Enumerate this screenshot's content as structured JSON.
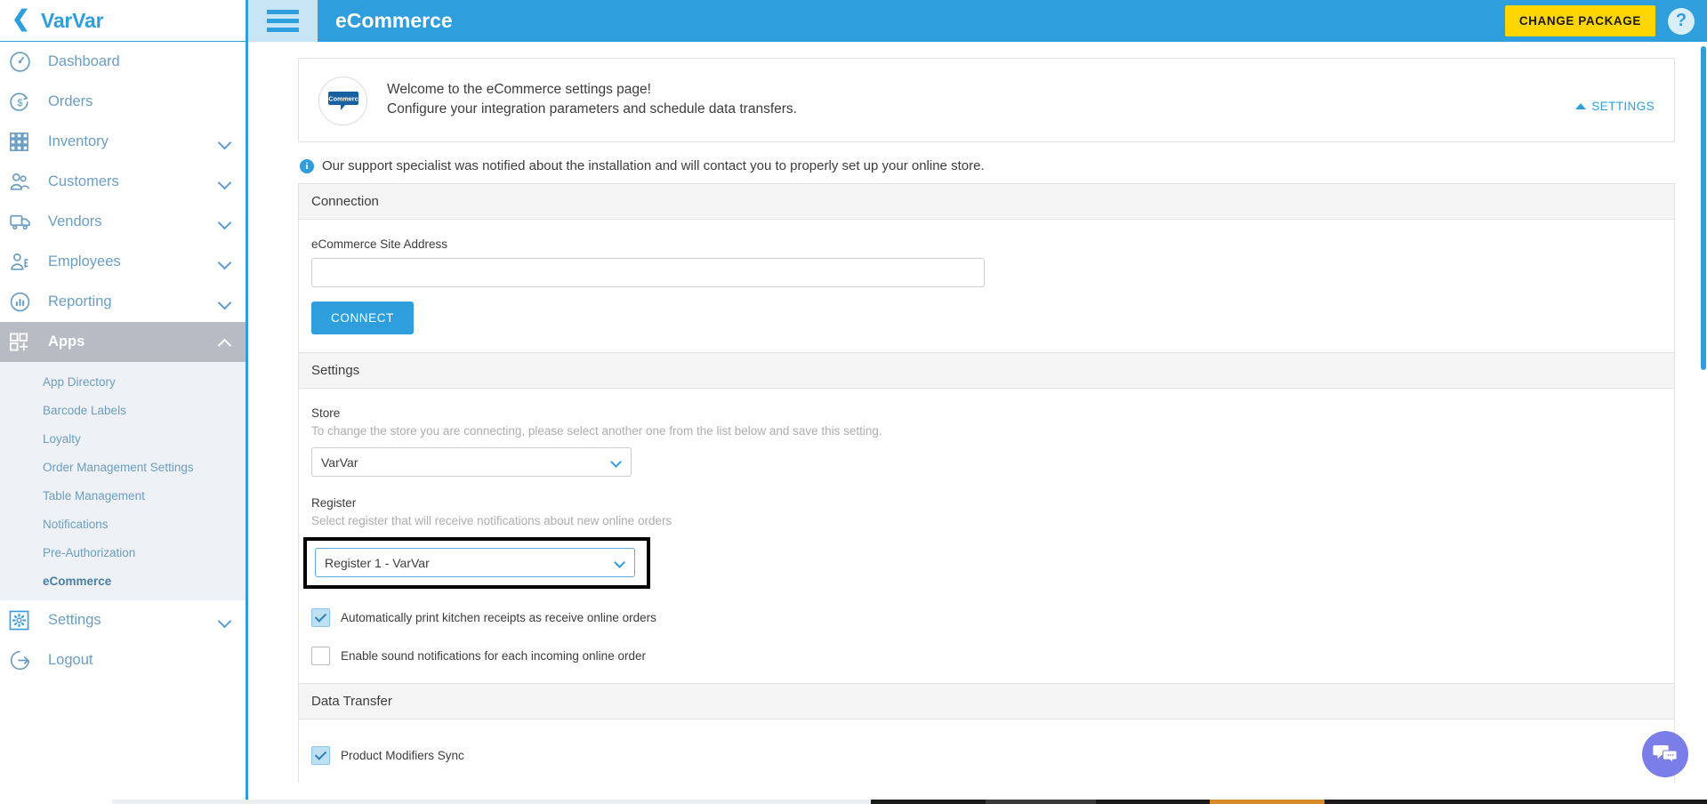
{
  "sidebar": {
    "brand": {
      "name": "VarVar",
      "back_icon": "chevron-left-icon"
    },
    "items": [
      {
        "label": "Dashboard",
        "icon": "dashboard-gauge-icon",
        "expandable": false,
        "active": false
      },
      {
        "label": "Orders",
        "icon": "dollar-refresh-icon",
        "expandable": false,
        "active": false
      },
      {
        "label": "Inventory",
        "icon": "grid-boxes-icon",
        "expandable": true,
        "active": false
      },
      {
        "label": "Customers",
        "icon": "two-people-icon",
        "expandable": true,
        "active": false
      },
      {
        "label": "Vendors",
        "icon": "truck-icon",
        "expandable": true,
        "active": false
      },
      {
        "label": "Employees",
        "icon": "person-badge-icon",
        "expandable": true,
        "active": false
      },
      {
        "label": "Reporting",
        "icon": "bar-chart-circle-icon",
        "expandable": true,
        "active": false
      },
      {
        "label": "Apps",
        "icon": "apps-plus-icon",
        "expandable": true,
        "active": true
      }
    ],
    "submenu": [
      {
        "label": "App Directory",
        "current": false
      },
      {
        "label": "Barcode Labels",
        "current": false
      },
      {
        "label": "Loyalty",
        "current": false
      },
      {
        "label": "Order Management Settings",
        "current": false
      },
      {
        "label": "Table Management",
        "current": false
      },
      {
        "label": "Notifications",
        "current": false
      },
      {
        "label": "Pre-Authorization",
        "current": false
      },
      {
        "label": "eCommerce",
        "current": true
      }
    ],
    "footer_items": [
      {
        "label": "Settings",
        "icon": "gear-icon",
        "expandable": true
      },
      {
        "label": "Logout",
        "icon": "logout-icon",
        "expandable": false
      }
    ]
  },
  "header": {
    "menu_icon": "hamburger-menu-icon",
    "title": "eCommerce",
    "change_package_label": "CHANGE PACKAGE",
    "help_icon": "question-mark-icon",
    "bg_color": "#2e9fdc",
    "change_package_color": "#ffd600"
  },
  "welcome": {
    "logo_icon": "ecommerce-speech-bubble-logo",
    "logo_text": "eCommerce",
    "line1": "Welcome to the eCommerce settings page!",
    "line2": "Configure your integration parameters and schedule data transfers.",
    "settings_link_label": "SETTINGS",
    "settings_link_icon": "chevron-up-icon"
  },
  "notice": {
    "icon": "info-icon",
    "text": "Our support specialist was notified about the installation and will contact you to properly set up your online store."
  },
  "connection": {
    "section_title": "Connection",
    "site_address_label": "eCommerce Site Address",
    "site_address_value": "",
    "site_address_placeholder": "",
    "connect_label": "CONNECT"
  },
  "settings": {
    "section_title": "Settings",
    "store": {
      "label": "Store",
      "hint": "To change the store you are connecting, please select another one from the list below and save this setting.",
      "selected": "VarVar",
      "options": [
        "VarVar"
      ]
    },
    "register": {
      "label": "Register",
      "hint": "Select register that will receive notifications about new online orders",
      "selected": "Register 1 - VarVar",
      "options": [
        "Register 1 - VarVar"
      ],
      "highlighted": true
    },
    "checkboxes": [
      {
        "label": "Automatically print kitchen receipts as receive online orders",
        "checked": true
      },
      {
        "label": "Enable sound notifications for each incoming online order",
        "checked": false
      }
    ]
  },
  "data_transfer": {
    "section_title": "Data Transfer",
    "checkboxes": [
      {
        "label": "Product Modifiers Sync",
        "checked": true
      }
    ]
  },
  "chat": {
    "icon": "chat-bubbles-icon",
    "color": "#7b7ee8"
  },
  "scrollbar": {
    "icon": "vertical-scrollbar",
    "color": "#2e9fdc"
  }
}
